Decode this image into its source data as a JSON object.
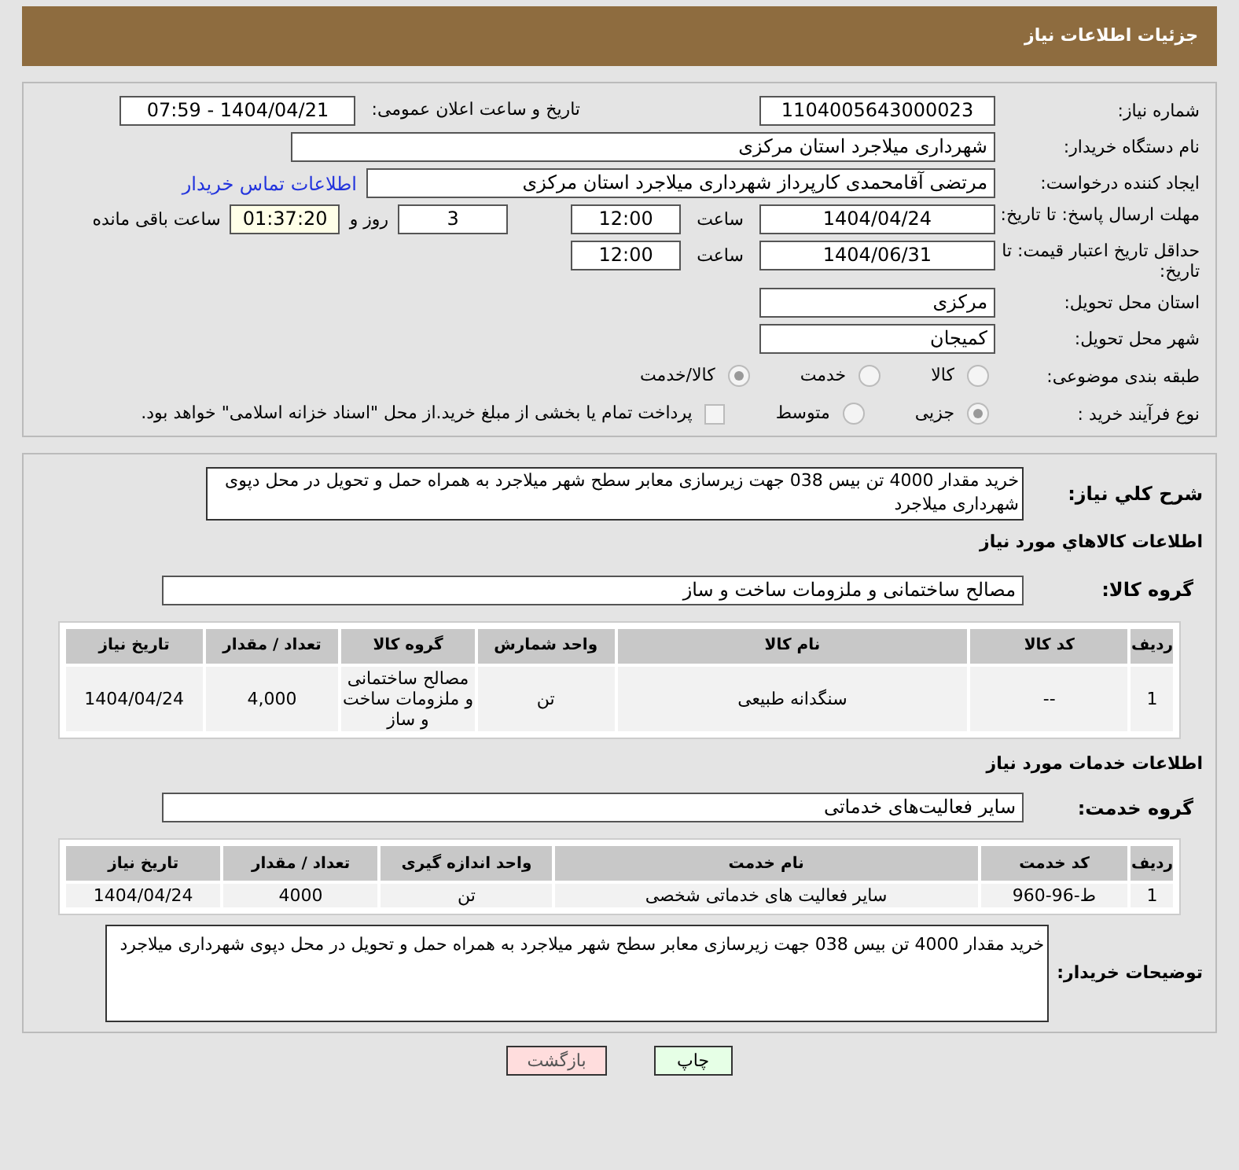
{
  "header": {
    "title": "جزئیات اطلاعات نیاز"
  },
  "need_number": {
    "label": "شماره نیاز:",
    "value": "1104005643000023"
  },
  "announce": {
    "label": "تاریخ و ساعت اعلان عمومی:",
    "value": "1404/04/21 - 07:59"
  },
  "buyer_org": {
    "label": "نام دستگاه خریدار:",
    "value": "شهرداری میلاجرد استان مرکزی"
  },
  "requester": {
    "label": "ایجاد کننده درخواست:",
    "value": "مرتضی  آقامحمدی  کارپرداز  شهرداری میلاجرد استان مرکزی",
    "link": "اطلاعات تماس خریدار"
  },
  "reply_deadline": {
    "label": "مهلت ارسال پاسخ: تا تاریخ:",
    "date": "1404/04/24",
    "time_label": "ساعت",
    "time": "12:00",
    "days": "3",
    "days_label": "روز و",
    "remaining": "01:37:20",
    "remaining_label": "ساعت باقی مانده"
  },
  "price_validity": {
    "label": "حداقل تاریخ اعتبار قیمت: تا تاریخ:",
    "date": "1404/06/31",
    "time_label": "ساعت",
    "time": "12:00"
  },
  "province": {
    "label": "استان محل تحویل:",
    "value": "مرکزی"
  },
  "city": {
    "label": "شهر محل تحویل:",
    "value": "کمیجان"
  },
  "category": {
    "label": "طبقه بندی موضوعی:",
    "options": [
      {
        "label": "کالا",
        "selected": false
      },
      {
        "label": "خدمت",
        "selected": false
      },
      {
        "label": "کالا/خدمت",
        "selected": true
      }
    ]
  },
  "process": {
    "label": "نوع فرآیند خرید :",
    "options": [
      {
        "label": "جزیی",
        "selected": true
      },
      {
        "label": "متوسط",
        "selected": false
      }
    ],
    "payment": {
      "checked": false,
      "label": "پرداخت تمام یا بخشی از مبلغ خرید.از محل \"اسناد خزانه اسلامی\" خواهد بود."
    }
  },
  "description": {
    "label": "شرح کلي نياز:",
    "value": "خرید مقدار 4000 تن بیس 038 جهت زیرسازی معابر سطح شهر میلاجرد  به همراه حمل و تحویل در محل دپوی شهرداری میلاجرد"
  },
  "goods": {
    "title": "اطلاعات کالاهاي مورد نياز",
    "group_label": "گروه کالا:",
    "group": "مصالح ساختمانی و ملزومات ساخت و ساز",
    "columns": [
      "ردیف",
      "کد کالا",
      "نام کالا",
      "واحد شمارش",
      "گروه کالا",
      "تعداد / مقدار",
      "تاریخ نیاز"
    ],
    "rows": [
      [
        "1",
        "--",
        "سنگدانه طبیعی",
        "تن",
        "مصالح ساختمانی و ملزومات ساخت و ساز",
        "4,000",
        "1404/04/24"
      ]
    ]
  },
  "services": {
    "title": "اطلاعات خدمات مورد نیاز",
    "group_label": "گروه خدمت:",
    "group": "سایر فعالیت‌های خدماتی",
    "columns": [
      "ردیف",
      "کد خدمت",
      "نام خدمت",
      "واحد اندازه گیری",
      "تعداد / مقدار",
      "تاریخ نیاز"
    ],
    "rows": [
      [
        "1",
        "ط-96-960",
        "سایر فعالیت های خدماتی شخصی",
        "تن",
        "4000",
        "1404/04/24"
      ]
    ]
  },
  "buyer_notes": {
    "label": "توضیحات خریدار:",
    "value": "خرید مقدار 4000 تن بیس 038 جهت زیرسازی معابر سطح شهر میلاجرد به همراه حمل و تحویل در محل دپوی شهرداری میلاجرد"
  },
  "buttons": [
    {
      "label": "چاپ",
      "kind": "print"
    },
    {
      "label": "بازگشت",
      "kind": "back"
    }
  ]
}
